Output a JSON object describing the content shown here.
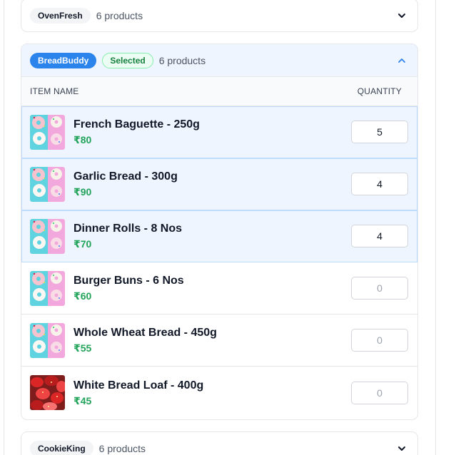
{
  "vendors": {
    "ovenfresh": {
      "name": "OvenFresh",
      "count": "6 products"
    },
    "breadbuddy": {
      "name": "BreadBuddy",
      "badge": "Selected",
      "count": "6 products",
      "columns": {
        "item": "ITEM NAME",
        "quantity": "QUANTITY"
      },
      "items": [
        {
          "name": "French Baguette - 250g",
          "price": "₹80",
          "qty": "5",
          "selected": true,
          "image": "donut"
        },
        {
          "name": "Garlic Bread - 300g",
          "price": "₹90",
          "qty": "4",
          "selected": true,
          "image": "donut"
        },
        {
          "name": "Dinner Rolls - 8 Nos",
          "price": "₹70",
          "qty": "4",
          "selected": true,
          "image": "donut"
        },
        {
          "name": "Burger Buns - 6 Nos",
          "price": "₹60",
          "qty": "0",
          "selected": false,
          "image": "donut"
        },
        {
          "name": "Whole Wheat Bread - 450g",
          "price": "₹55",
          "qty": "0",
          "selected": false,
          "image": "donut"
        },
        {
          "name": "White Bread Loaf - 400g",
          "price": "₹45",
          "qty": "0",
          "selected": false,
          "image": "strawberry"
        }
      ]
    },
    "cookieking": {
      "name": "CookieKing",
      "count": "6 products"
    }
  },
  "colors": {
    "accent": "#2b83ec",
    "price": "#22a35a",
    "selected_row": "#eef5ff",
    "badge": "#15803d"
  },
  "icons": {
    "collapsed": "chevron-down-icon",
    "expanded": "chevron-up-icon"
  }
}
